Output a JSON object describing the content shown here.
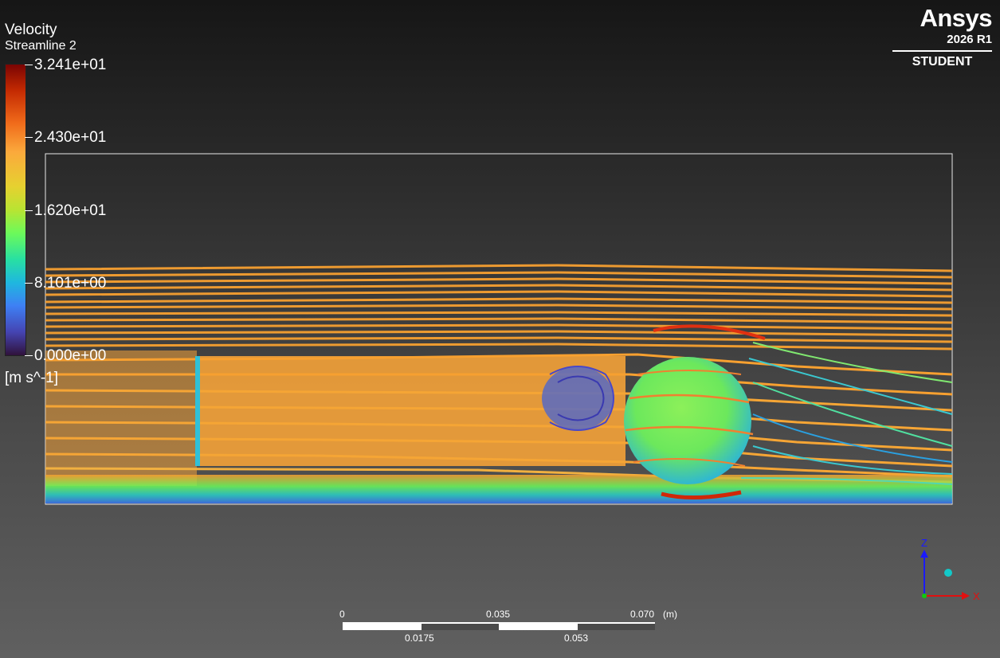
{
  "legend": {
    "title": "Velocity",
    "subtitle": "Streamline 2",
    "ticks": [
      "3.241e+01",
      "2.430e+01",
      "1.620e+01",
      "8.101e+00",
      "0.000e+00"
    ],
    "unit": "[m s^-1]"
  },
  "branding": {
    "name": "Ansys",
    "version": "2026 R1",
    "edition": "STUDENT"
  },
  "scale_bar": {
    "top_labels": [
      "0",
      "0.035",
      "0.070"
    ],
    "unit": "(m)",
    "bottom_labels": [
      "0.0175",
      "0.053"
    ]
  },
  "axes": {
    "z_label": "Z",
    "x_label": "X",
    "z_color": "#1a1aff",
    "x_color": "#e01010",
    "y_color": "#12c8c8"
  },
  "colors": {
    "colormap_max": "#7a0403",
    "colormap_min": "#30123b",
    "freestream": "#f7a030"
  }
}
